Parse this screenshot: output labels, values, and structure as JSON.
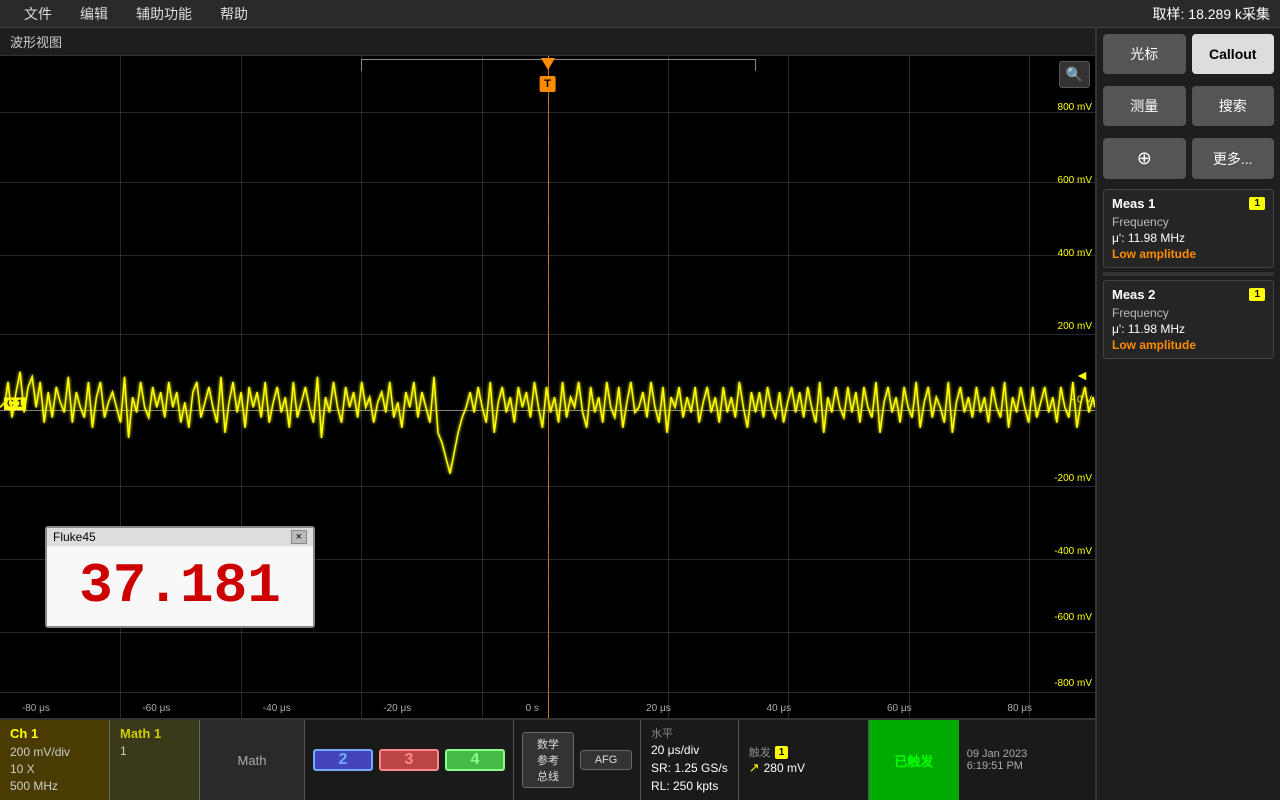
{
  "menu": {
    "file": "文件",
    "edit": "编辑",
    "utility": "辅助功能",
    "help": "帮助",
    "status": "取样: 18.289 k采集"
  },
  "waveform": {
    "title": "波形视图"
  },
  "yLabels": [
    {
      "value": "800 mV",
      "pct": 8
    },
    {
      "value": "600 mV",
      "pct": 18
    },
    {
      "value": "400 mV",
      "pct": 30
    },
    {
      "value": "200 mV",
      "pct": 42
    },
    {
      "value": "0 V",
      "pct": 54
    },
    {
      "value": "-200 mV",
      "pct": 65
    },
    {
      "value": "-400 mV",
      "pct": 75
    },
    {
      "value": "-600 mV",
      "pct": 85
    },
    {
      "value": "-800 mV",
      "pct": 95
    }
  ],
  "xLabels": [
    {
      "value": "-80 μs",
      "pct": 3
    },
    {
      "value": "-60 μs",
      "pct": 14
    },
    {
      "value": "-40 μs",
      "pct": 25
    },
    {
      "value": "-20 μs",
      "pct": 36
    },
    {
      "value": "0 s",
      "pct": 50
    },
    {
      "value": "20 μs",
      "pct": 61
    },
    {
      "value": "40 μs",
      "pct": 72
    },
    {
      "value": "60 μs",
      "pct": 83
    },
    {
      "value": "80 μs",
      "pct": 94
    }
  ],
  "fluke": {
    "title": "Fluke45",
    "value": "37.181",
    "close": "×"
  },
  "meas1": {
    "title": "Meas 1",
    "badge": "1",
    "param1": "Frequency",
    "val1": "μ': 11.98 MHz",
    "warning": "Low amplitude"
  },
  "meas2": {
    "title": "Meas 2",
    "badge": "1",
    "param1": "Frequency",
    "val1": "μ': 11.98 MHz",
    "warning": "Low amplitude"
  },
  "rightPanel": {
    "cursor": "光标",
    "callout": "Callout",
    "measure": "测量",
    "search": "搜索",
    "zoomIcon": "⊕",
    "more": "更多..."
  },
  "ch1": {
    "label": "Ch 1",
    "vdiv": "200 mV/div",
    "coupling": "10 X",
    "bw": "500 MHz"
  },
  "math1": {
    "label": "Math 1",
    "value": "1"
  },
  "mathLabel": "Math",
  "chButtons": {
    "ch2": "2",
    "ch3": "3",
    "ch4": "4"
  },
  "funcButtons": {
    "math": "数学\n参考\n总线",
    "afg": "AFG"
  },
  "horizontal": {
    "label": "水平",
    "div": "20 μs/div",
    "sr": "SR: 1.25 GS/s",
    "rl": "RL: 250 kpts"
  },
  "trigger": {
    "label": "触发",
    "badge": "1",
    "slope": "↗",
    "value": "280 mV"
  },
  "triggered": "已触发",
  "datetime": {
    "date": "09 Jan 2023",
    "time": "6:19:51 PM"
  }
}
